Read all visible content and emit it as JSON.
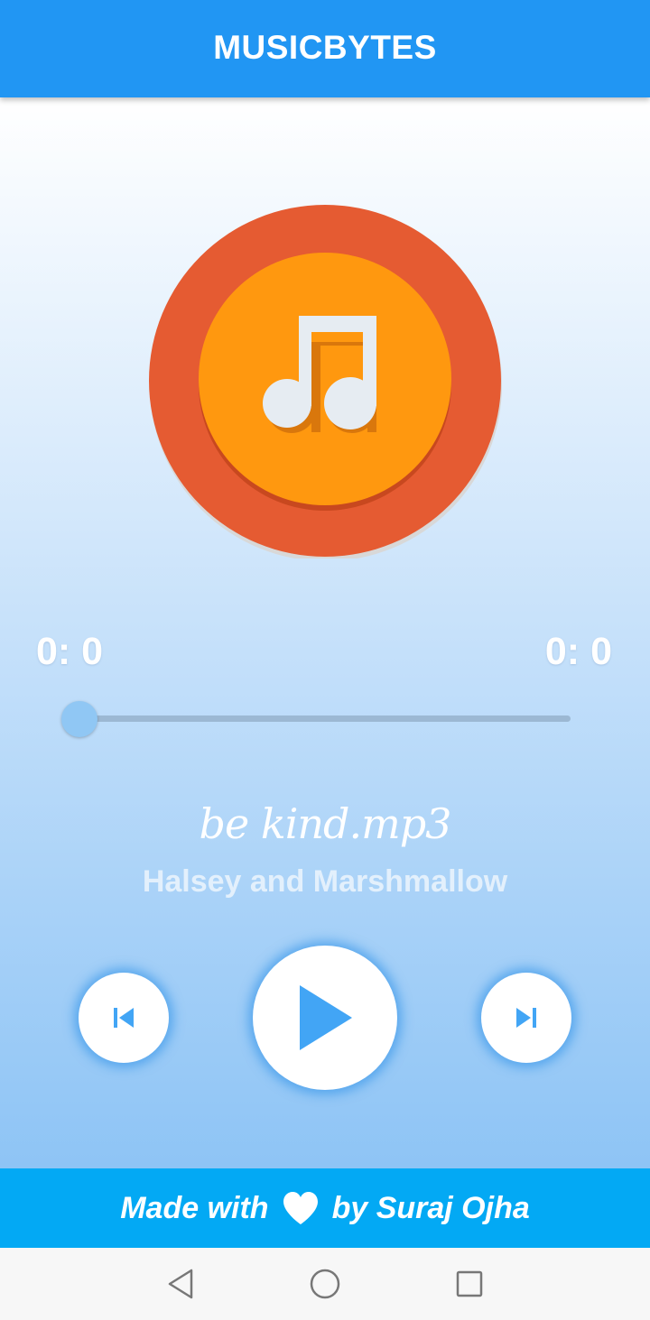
{
  "app_bar": {
    "title": "MUSICBYTES"
  },
  "player": {
    "elapsed": "0: 0",
    "duration": "0: 0",
    "progress": 0,
    "song_title": "be kind.mp3",
    "artist": "Halsey and Marshmallow"
  },
  "controls": {
    "previous_icon": "skip-previous-icon",
    "play_icon": "play-icon",
    "next_icon": "skip-next-icon"
  },
  "footer": {
    "prefix": "Made with",
    "suffix": "by Suraj Ojha",
    "icon": "heart-icon"
  },
  "system_nav": {
    "back_icon": "back-triangle-icon",
    "home_icon": "home-circle-icon",
    "recents_icon": "recents-square-icon"
  },
  "colors": {
    "app_bar": "#2196F3",
    "footer": "#03A9F4",
    "disc_outer": "#E55B32",
    "disc_inner": "#FF980F",
    "accent": "#42A5F5"
  }
}
